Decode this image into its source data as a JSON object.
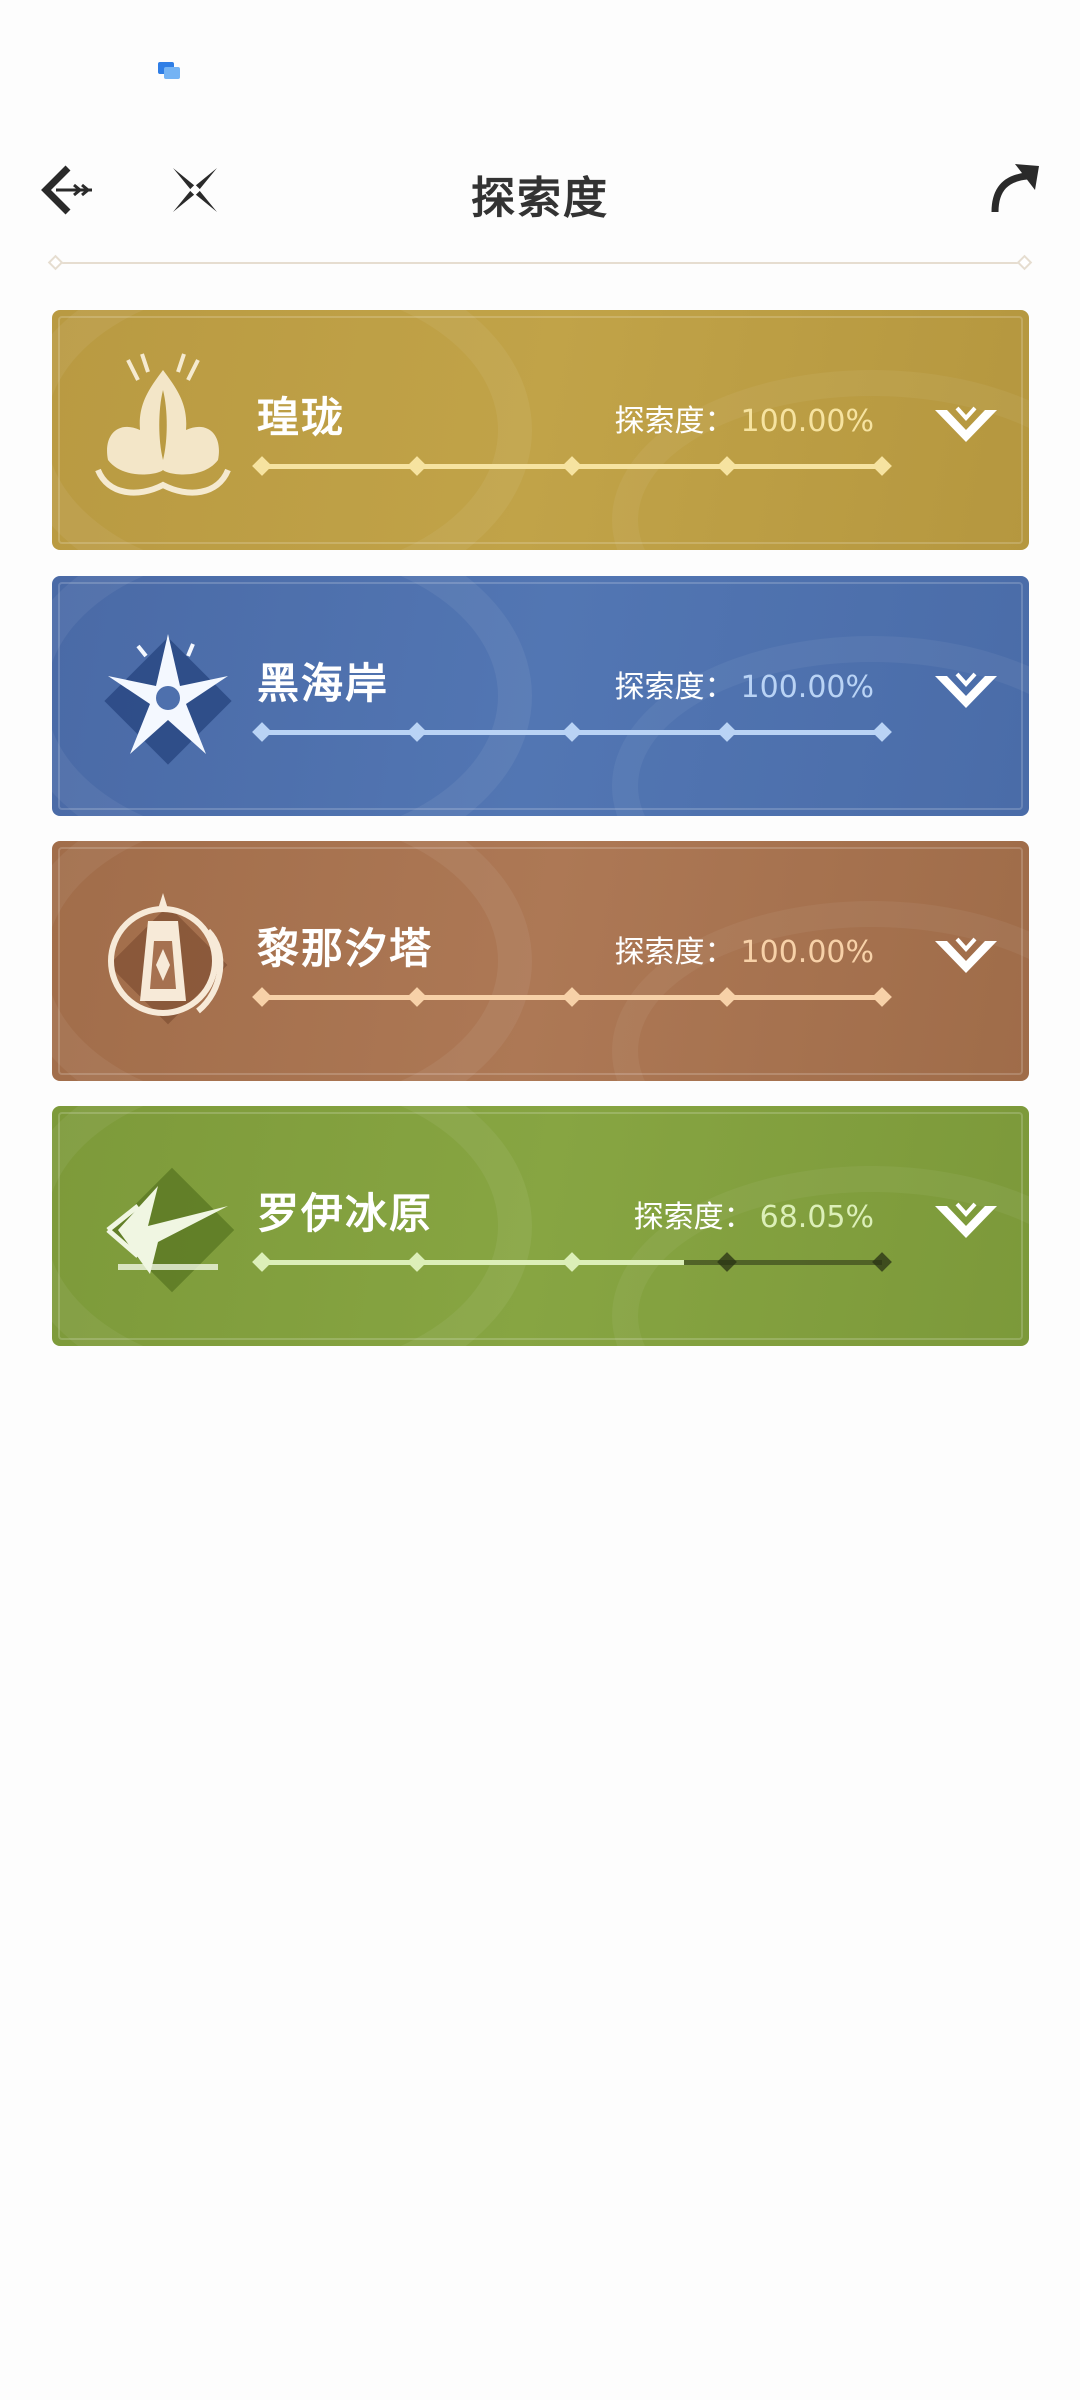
{
  "header": {
    "title": "探索度"
  },
  "regions": [
    {
      "name": "瑝珑",
      "progress_label": "探索度：",
      "progress_value": "100.00%",
      "progress_fraction": 1.0,
      "bg_color": "#bb9c43",
      "track_color": "#f6e3a0",
      "value_color": "#f6e3a0",
      "emblem": "dragon-emblem-icon"
    },
    {
      "name": "黑海岸",
      "progress_label": "探索度：",
      "progress_value": "100.00%",
      "progress_fraction": 1.0,
      "bg_color": "#4e70ad",
      "track_color": "#b9d3f5",
      "value_color": "#b9d3f5",
      "emblem": "star-flower-emblem-icon"
    },
    {
      "name": "黎那汐塔",
      "progress_label": "探索度：",
      "progress_value": "100.00%",
      "progress_fraction": 1.0,
      "bg_color": "#a67150",
      "track_color": "#f7d1a8",
      "value_color": "#f7d1a8",
      "emblem": "lantern-emblem-icon"
    },
    {
      "name": "罗伊冰原",
      "progress_label": "探索度：",
      "progress_value": "68.05%",
      "progress_fraction": 0.6805,
      "bg_color": "#82a03e",
      "track_color": "#dcefb8",
      "value_color": "#dcefb8",
      "emblem": "ice-blade-emblem-icon"
    }
  ]
}
